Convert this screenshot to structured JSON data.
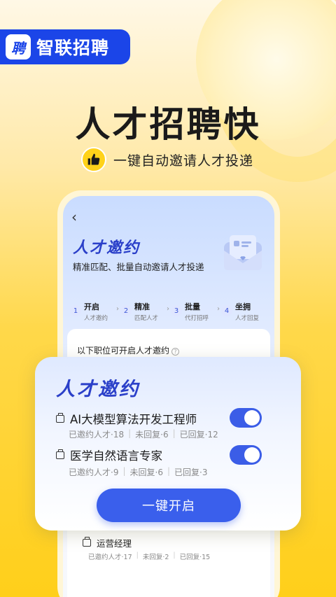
{
  "brand": {
    "badge": "聘",
    "name": "智联招聘"
  },
  "headline": "人才招聘快",
  "subheadline": "一键自动邀请人才投递",
  "phone": {
    "back_icon": "‹",
    "title": "人才邀约",
    "subtitle": "精准匹配、批量自动邀请人才投递",
    "steps": [
      {
        "num": "1",
        "title": "开启",
        "sub": "人才邀约"
      },
      {
        "num": "2",
        "title": "精准",
        "sub": "匹配人才"
      },
      {
        "num": "3",
        "title": "批量",
        "sub": "代打招呼"
      },
      {
        "num": "4",
        "title": "坐拥",
        "sub": "人才回复"
      }
    ],
    "list_heading": "以下职位可开启人才邀约",
    "help_icon": "?",
    "job3": {
      "name": "运营经理",
      "stats": [
        "已邀约人才·17",
        "未回复·2",
        "已回复·15"
      ]
    }
  },
  "overlay": {
    "title": "人才邀约",
    "jobs": [
      {
        "name": "AI大模型算法开发工程师",
        "stats": [
          "已邀约人才·18",
          "未回复·6",
          "已回复·12"
        ],
        "enabled": true
      },
      {
        "name": "医学自然语言专家",
        "stats": [
          "已邀约人才·9",
          "未回复·6",
          "已回复·3"
        ],
        "enabled": true
      }
    ],
    "cta": "一键开启"
  },
  "colors": {
    "brand_blue": "#1b45e8",
    "accent_yellow": "#ffd21a",
    "toggle_on": "#3b5de7"
  }
}
